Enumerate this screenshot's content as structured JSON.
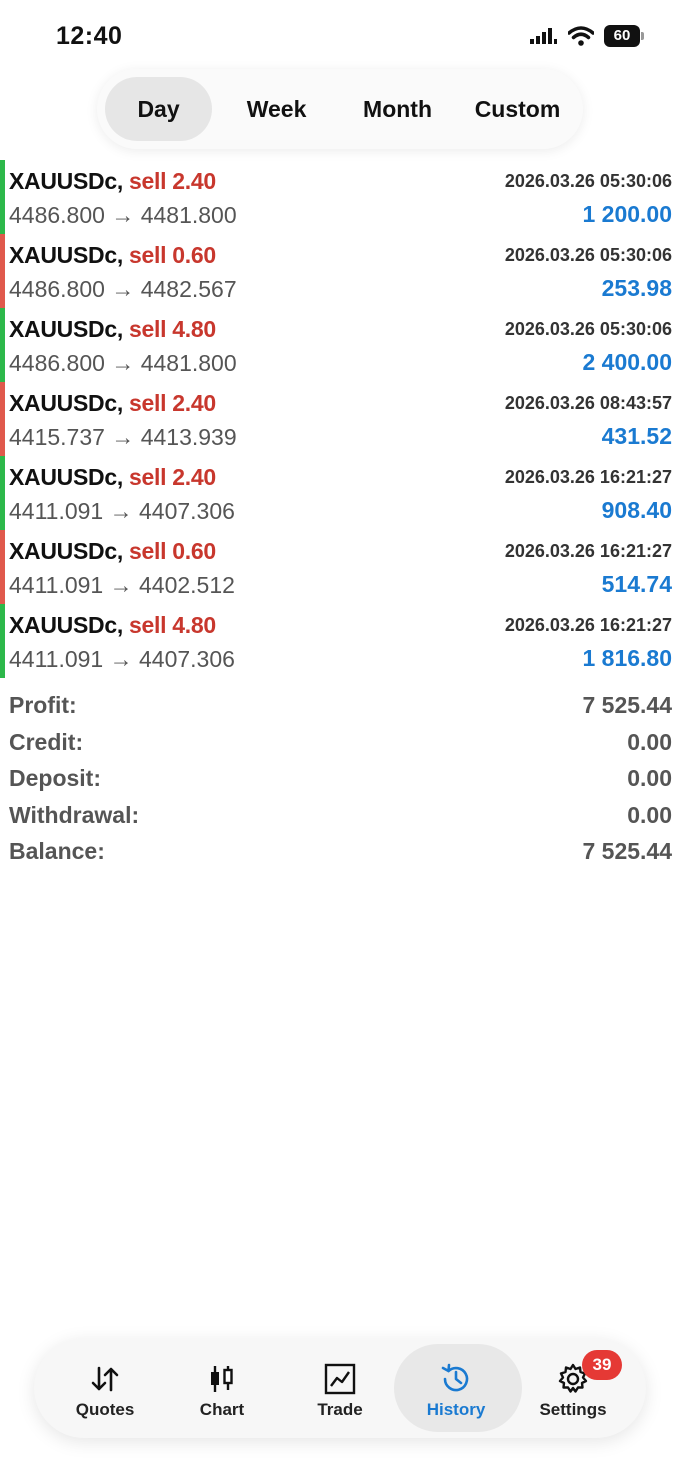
{
  "status_bar": {
    "time": "12:40",
    "battery": "60"
  },
  "tabs": [
    {
      "label": "Day",
      "active": true
    },
    {
      "label": "Week",
      "active": false
    },
    {
      "label": "Month",
      "active": false
    },
    {
      "label": "Custom",
      "active": false
    }
  ],
  "deals": [
    {
      "symbol": "XAUUSDc,",
      "side": "sell 2.40",
      "time": "2026.03.26 05:30:06",
      "prices": "4486.800 → 4481.800",
      "profit": "1 200.00",
      "bar_color": "#2db84a"
    },
    {
      "symbol": "XAUUSDc,",
      "side": "sell 0.60",
      "time": "2026.03.26 05:30:06",
      "prices": "4486.800 → 4482.567",
      "profit": "253.98",
      "bar_color": "#e0594c"
    },
    {
      "symbol": "XAUUSDc,",
      "side": "sell 4.80",
      "time": "2026.03.26 05:30:06",
      "prices": "4486.800 → 4481.800",
      "profit": "2 400.00",
      "bar_color": "#2db84a"
    },
    {
      "symbol": "XAUUSDc,",
      "side": "sell 2.40",
      "time": "2026.03.26 08:43:57",
      "prices": "4415.737 → 4413.939",
      "profit": "431.52",
      "bar_color": "#e0594c"
    },
    {
      "symbol": "XAUUSDc,",
      "side": "sell 2.40",
      "time": "2026.03.26 16:21:27",
      "prices": "4411.091 → 4407.306",
      "profit": "908.40",
      "bar_color": "#2db84a"
    },
    {
      "symbol": "XAUUSDc,",
      "side": "sell 0.60",
      "time": "2026.03.26 16:21:27",
      "prices": "4411.091 → 4402.512",
      "profit": "514.74",
      "bar_color": "#e0594c"
    },
    {
      "symbol": "XAUUSDc,",
      "side": "sell 4.80",
      "time": "2026.03.26 16:21:27",
      "prices": "4411.091 → 4407.306",
      "profit": "1 816.80",
      "bar_color": "#2db84a"
    }
  ],
  "summary": [
    {
      "label": "Profit:",
      "value": "7 525.44"
    },
    {
      "label": "Credit:",
      "value": "0.00"
    },
    {
      "label": "Deposit:",
      "value": "0.00"
    },
    {
      "label": "Withdrawal:",
      "value": "0.00"
    },
    {
      "label": "Balance:",
      "value": "7 525.44"
    }
  ],
  "nav": [
    {
      "label": "Quotes",
      "icon": "quotes-icon",
      "active": false
    },
    {
      "label": "Chart",
      "icon": "candlestick-icon",
      "active": false
    },
    {
      "label": "Trade",
      "icon": "trade-chart-icon",
      "active": false
    },
    {
      "label": "History",
      "icon": "history-icon",
      "active": true
    },
    {
      "label": "Settings",
      "icon": "gear-icon",
      "active": false
    }
  ],
  "settings_badge": "39",
  "colors": {
    "accent": "#1a7ad1",
    "sell": "#c8372d",
    "profit_bar": "#2db84a",
    "loss_bar": "#e0594c"
  }
}
